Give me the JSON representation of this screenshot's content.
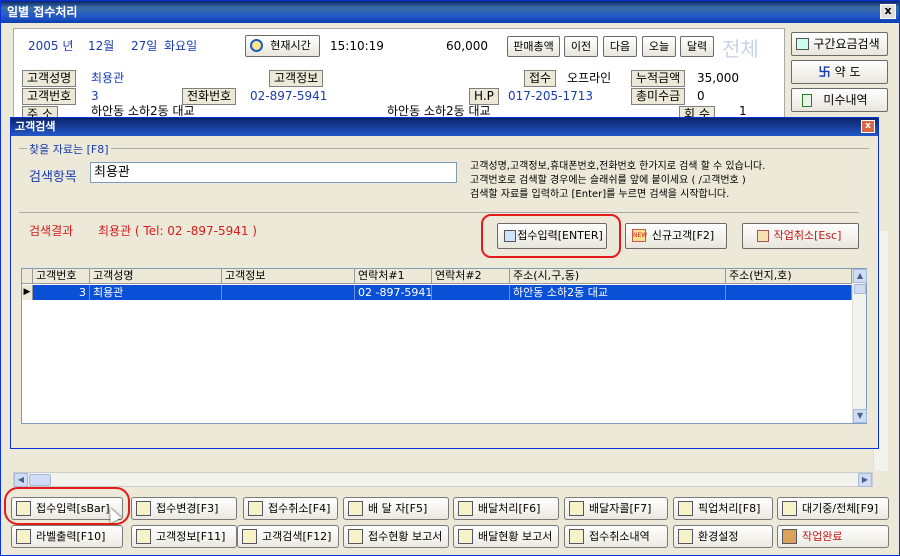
{
  "window": {
    "title": "일별 접수처리",
    "close": "x"
  },
  "header": {
    "year": "2005 년",
    "month": "12월",
    "day": "27일",
    "weekday": "화요일",
    "time_button": "현재시간",
    "time": "15:10:19",
    "amount": "60,000",
    "nav": [
      "판매총액",
      "이전",
      "다음",
      "오늘",
      "달력"
    ],
    "all_label": "전체"
  },
  "customer": {
    "name_label": "고객성명",
    "name": "최용관",
    "info_label": "고객정보",
    "id_label": "고객번호",
    "id": "3",
    "phone_label": "전화번호",
    "phone": "02-897-5941",
    "hp_label": "H.P",
    "hp": "017-205-1713",
    "addr_label": "주      소",
    "addr1": "하안동 소하2동 대교",
    "addr2": "하안동 소하2동 대교",
    "receive_label": "접수",
    "receive_value": "오프라인",
    "accum_label": "누적금액",
    "accum_value": "35,000",
    "unpaid_label": "총미수금",
    "unpaid_value": "0",
    "count_label": "회   수",
    "count_value": "1"
  },
  "right_buttons": [
    "구간요금검색",
    "약 도",
    "미수내역"
  ],
  "dialog": {
    "title": "고객검색",
    "close": "x",
    "group_label": "찾을 자료는 [F8]",
    "field_label": "검색항목",
    "field_value": "최용관",
    "help": [
      "고객성명,고객정보,휴대폰번호,전화번호 한가지로 검색 할 수 있습니다.",
      "고객번호로 검색할 경우에는 슬래쉬를 앞에 붙이세요 ( /고객번호 )",
      "검색할 자료를 입력하고 [Enter]를 누르면 검색을 시작합니다."
    ],
    "result_label": "검색결과",
    "result_value": "최용관 ( Tel: 02  -897-5941 )",
    "buttons": [
      "접수입력[ENTER]",
      "신규고객[F2]",
      "작업취소[Esc]"
    ],
    "columns": [
      "고객번호",
      "고객성명",
      "고객정보",
      "연락처#1",
      "연락처#2",
      "주소(시,구,동)",
      "주소(번지,호)"
    ],
    "row": [
      "3",
      "최용관",
      "",
      "02  -897-5941",
      "",
      "하안동 소하2동 대교",
      ""
    ]
  },
  "toolbar": {
    "row1": [
      "접수입력[sBar]",
      "접수변경[F3]",
      "접수취소[F4]",
      "배 달 자[F5]",
      "배달처리[F6]",
      "배달자콜[F7]",
      "픽업처리[F8]",
      "대기중/전체[F9]"
    ],
    "row2": [
      "라벨출력[F10]",
      "고객정보[F11]",
      "고객검색[F12]",
      "접수현황 보고서",
      "배달현황 보고서",
      "접수취소내역",
      "환경설정",
      "작업완료"
    ]
  },
  "colors": {
    "accent": "#1a3bb0",
    "selection": "#0a50d6",
    "highlight_ring": "#e21b1b",
    "title_bar": "#0a246a"
  }
}
